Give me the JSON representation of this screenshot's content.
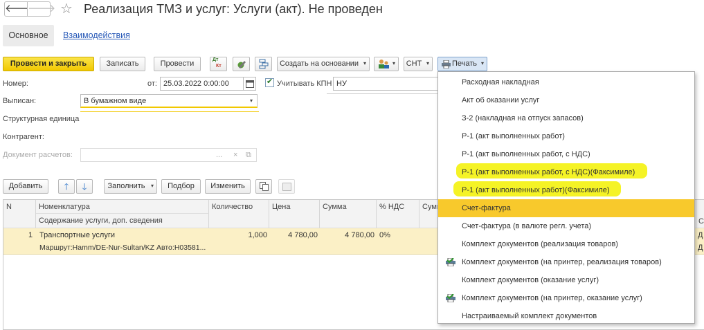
{
  "window": {
    "title": "Реализация ТМЗ и услуг: Услуги (акт). Не проведен",
    "back_glyph": "🡐",
    "forward_glyph": "🡒",
    "favorite_glyph": "☆"
  },
  "tabs": [
    {
      "label": "Основное"
    },
    {
      "label": "Взаимодействия"
    }
  ],
  "toolbar": {
    "post_close": "Провести и закрыть",
    "save": "Записать",
    "post": "Провести",
    "dt_kt_top": "Дт",
    "dt_kt_bottom": "Кт",
    "create_based": "Создать на основании",
    "snt": "СНТ",
    "print": "Печать",
    "dropdown_arrow": "▾"
  },
  "form": {
    "number_label": "Номер:",
    "date_label": "от:",
    "date_value": "25.03.2022  0:00:00",
    "kpn_label": "Учитывать КПН",
    "kpn_value": "НУ",
    "issued_label": "Выписан:",
    "issued_value": "В бумажном виде",
    "unit_label": "Структурная единица",
    "counterparty_label": "Контрагент:",
    "settlement_doc_label": "Документ расчетов:",
    "ellipsis": "...",
    "clear": "×"
  },
  "table_toolbar": {
    "add": "Добавить",
    "fill": "Заполнить",
    "pick": "Подбор",
    "change": "Изменить"
  },
  "table": {
    "headers": {
      "n": "N",
      "nomenclature": "Номенклатура",
      "qty": "Количество",
      "price": "Цена",
      "sum": "Сумма",
      "vat_pct": "% НДС",
      "vat_sum": "Сумм",
      "service_content": "Содержание услуги, доп. сведения"
    },
    "rows": [
      {
        "n": "1",
        "nomenclature": "Транспортные услуги",
        "detail": "Маршрут:Hamm/DE-Nur-Sultan/KZ Авто:H03581...",
        "qty": "1,000",
        "price": "4 780,00",
        "sum": "4 780,00",
        "vat_pct": "0%"
      }
    ],
    "right_cut": {
      "h1": "С",
      "r1": "Д",
      "r2": "Д"
    }
  },
  "print_menu": {
    "items": [
      {
        "label": "Расходная накладная"
      },
      {
        "label": "Акт об оказании услуг"
      },
      {
        "label": "З-2 (накладная на отпуск запасов)"
      },
      {
        "label": "Р-1 (акт выполненных работ)"
      },
      {
        "label": "Р-1 (акт выполненных работ, с НДС)"
      },
      {
        "label": "Р-1 (акт выполненных работ, с НДС)(Факсимиле)"
      },
      {
        "label": "Р-1 (акт выполненных работ)(Факсимиле)"
      },
      {
        "label": "Счет-фактура"
      },
      {
        "label": "Счет-фактура (в валюте регл. учета)"
      },
      {
        "label": "Комплект документов (реализация товаров)"
      },
      {
        "label": "Комплект документов (на принтер, реализация товаров)"
      },
      {
        "label": "Комплект документов (оказание услуг)"
      },
      {
        "label": "Комплект документов (на принтер, оказание услуг)"
      },
      {
        "label": "Настраиваемый комплект документов"
      }
    ],
    "selected_index": 7,
    "highlighted_indices": [
      5,
      6
    ],
    "colors": {
      "selected": "#f8c92c",
      "marker_highlight": "#f4f21a",
      "primary_button": "#f1c800"
    }
  }
}
